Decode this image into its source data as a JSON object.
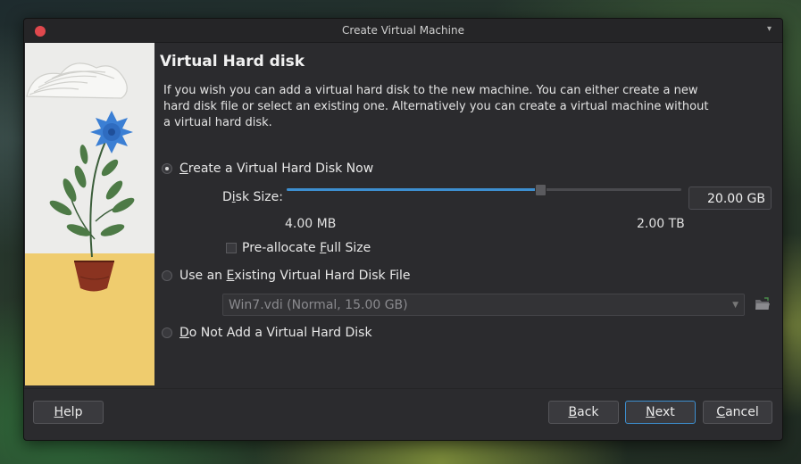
{
  "window": {
    "title": "Create Virtual Machine"
  },
  "page": {
    "heading": "Virtual Hard disk",
    "description": "If you wish you can add a virtual hard disk to the new machine. You can either create a new hard disk file or select an existing one. Alternatively you can create a virtual machine without a virtual hard disk."
  },
  "options": {
    "create_now": {
      "label_prefix": "",
      "label_key": "C",
      "label_rest": "reate a Virtual Hard Disk Now",
      "checked": true
    },
    "use_existing": {
      "label_prefix": "Use an ",
      "label_key": "E",
      "label_rest": "xisting Virtual Hard Disk File",
      "checked": false
    },
    "do_not_add": {
      "label_prefix": "",
      "label_key": "D",
      "label_rest": "o Not Add a Virtual Hard Disk",
      "checked": false
    }
  },
  "disk_size": {
    "label_prefix": "D",
    "label_key": "i",
    "label_rest": "sk Size:",
    "value": "20.00 GB",
    "min_label": "4.00 MB",
    "max_label": "2.00 TB",
    "slider_fraction": 0.64
  },
  "preallocate": {
    "label_prefix": "Pre-allocate ",
    "label_key": "F",
    "label_rest": "ull Size",
    "checked": false
  },
  "existing_file": {
    "selected": "Win7.vdi (Normal, 15.00 GB)"
  },
  "buttons": {
    "help": {
      "key": "H",
      "rest": "elp"
    },
    "back": {
      "key": "B",
      "rest": "ack"
    },
    "next": {
      "key": "N",
      "rest": "ext"
    },
    "cancel": {
      "key": "C",
      "rest": "ancel"
    }
  },
  "colors": {
    "accent": "#3d8fd0",
    "close": "#e0484d",
    "flower": "#3b7fd4",
    "pot": "#8a3320",
    "ground": "#efcc6e"
  },
  "icons": {
    "close": "close-icon",
    "menu": "chevron-down-icon",
    "folder": "folder-open-icon",
    "select": "chevron-down-icon"
  }
}
